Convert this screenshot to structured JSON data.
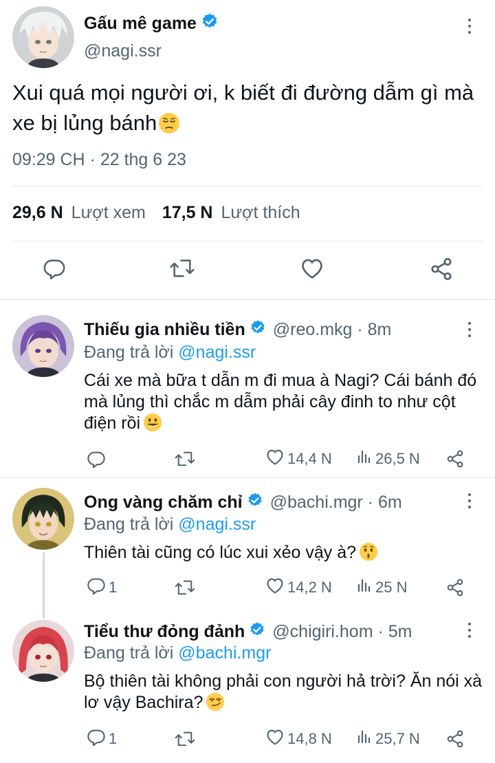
{
  "main_tweet": {
    "name": "Gấu mê game",
    "handle": "@nagi.ssr",
    "text": "Xui quá mọi người ơi, k biết đi đường dẫm gì mà xe bị lủng bánh",
    "time": "09:29 CH · 22 thg 6 23",
    "views_count": "29,6 N",
    "views_label": "Lượt xem",
    "likes_count": "17,5 N",
    "likes_label": "Lượt thích"
  },
  "replies": [
    {
      "name": "Thiếu gia nhiều tiền",
      "handle": "@reo.mkg · 8m",
      "replying_prefix": "Đang trả lời ",
      "replying_to": "@nagi.ssr",
      "text": "Cái xe mà bữa t dẫn m đi mua à Nagi? Cái bánh đó mà lủng thì chắc m dẫm phải cây đinh to như cột điện rồi",
      "reply_count": "",
      "like_count": "14,4 N",
      "view_count": "26,5 N",
      "avatar_hair": "#7b55b0"
    },
    {
      "name": "Ong vàng chăm chỉ",
      "handle": "@bachi.mgr · 6m",
      "replying_prefix": "Đang trả lời ",
      "replying_to": "@nagi.ssr",
      "text": "Thiên tài cũng có lúc xui xẻo vậy à?",
      "reply_count": "1",
      "like_count": "14,2 N",
      "view_count": "25 N",
      "avatar_hair": "#1f2a1f"
    },
    {
      "name": "Tiểu thư đỏng đảnh",
      "handle": "@chigiri.hom · 5m",
      "replying_prefix": "Đang trả lời ",
      "replying_to": "@bachi.mgr",
      "text": "Bộ thiên tài không phải con người hả trời? Ăn nói xà lơ vậy Bachira?",
      "reply_count": "1",
      "like_count": "14,8 N",
      "view_count": "25,7 N",
      "avatar_hair": "#d8434e"
    }
  ],
  "colors": {
    "accent": "#1d9bf0",
    "secondary_text": "#536471",
    "divider": "#e1e6ea"
  },
  "icons": {
    "reply": "reply-icon",
    "retweet": "retweet-icon",
    "like": "like-icon",
    "views": "views-icon",
    "share": "share-icon",
    "more": "more-icon",
    "verified": "verified-icon"
  }
}
